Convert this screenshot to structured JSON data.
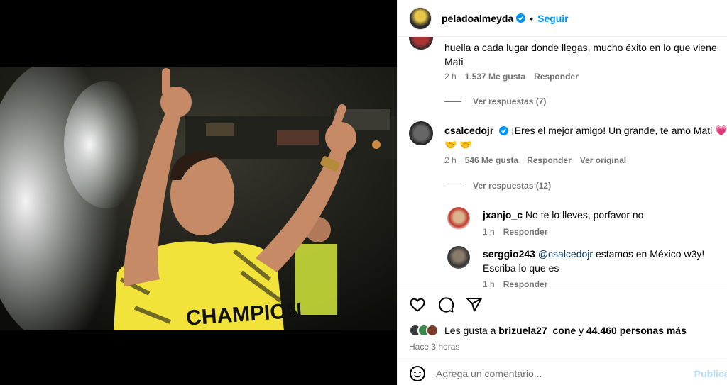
{
  "post": {
    "author": "peladoalmeyda",
    "follow_label": "Seguir",
    "separator": "•"
  },
  "comments": [
    {
      "text_line1": "huella a cada lugar donde llegas, mucho éxito en lo que viene",
      "text_line2": "Mati",
      "time": "2 h",
      "likes": "1.537 Me gusta",
      "reply": "Responder",
      "view_replies": "Ver respuestas (7)"
    },
    {
      "username": "csalcedojr",
      "text_line1": "¡Eres el mejor amigo! Un grande, te amo Mati",
      "heart": "💗",
      "hands": "🤝 🤝",
      "time": "2 h",
      "likes": "546 Me gusta",
      "reply": "Responder",
      "original": "Ver original",
      "view_replies": "Ver respuestas (12)"
    }
  ],
  "replies": [
    {
      "username": "jxanjo_c",
      "text": "No te lo lleves, porfavor no",
      "time": "1 h",
      "reply": "Responder"
    },
    {
      "username": "serggio243",
      "mention": "@csalcedojr",
      "text_line1": "estamos en México w3y!",
      "text_line2": "Escriba lo que es",
      "time": "1 h",
      "reply": "Responder"
    }
  ],
  "likes_bar": {
    "prefix": "Les gusta a",
    "user": "brizuela27_cone",
    "conjunction": "y",
    "count": "44.460 personas más"
  },
  "timestamp": "Hace 3 horas",
  "comment_input": {
    "placeholder": "Agrega un comentario...",
    "publish": "Publicar"
  },
  "icons": {
    "like": "heart-icon",
    "comment": "comment-icon",
    "share": "share-icon",
    "emoji": "emoji-icon",
    "verified": "verified-badge-icon"
  },
  "colors": {
    "link_blue": "#0095f6",
    "muted_gray": "#737373",
    "mention_blue": "#00376b",
    "jersey_yellow": "#f2e33a"
  }
}
